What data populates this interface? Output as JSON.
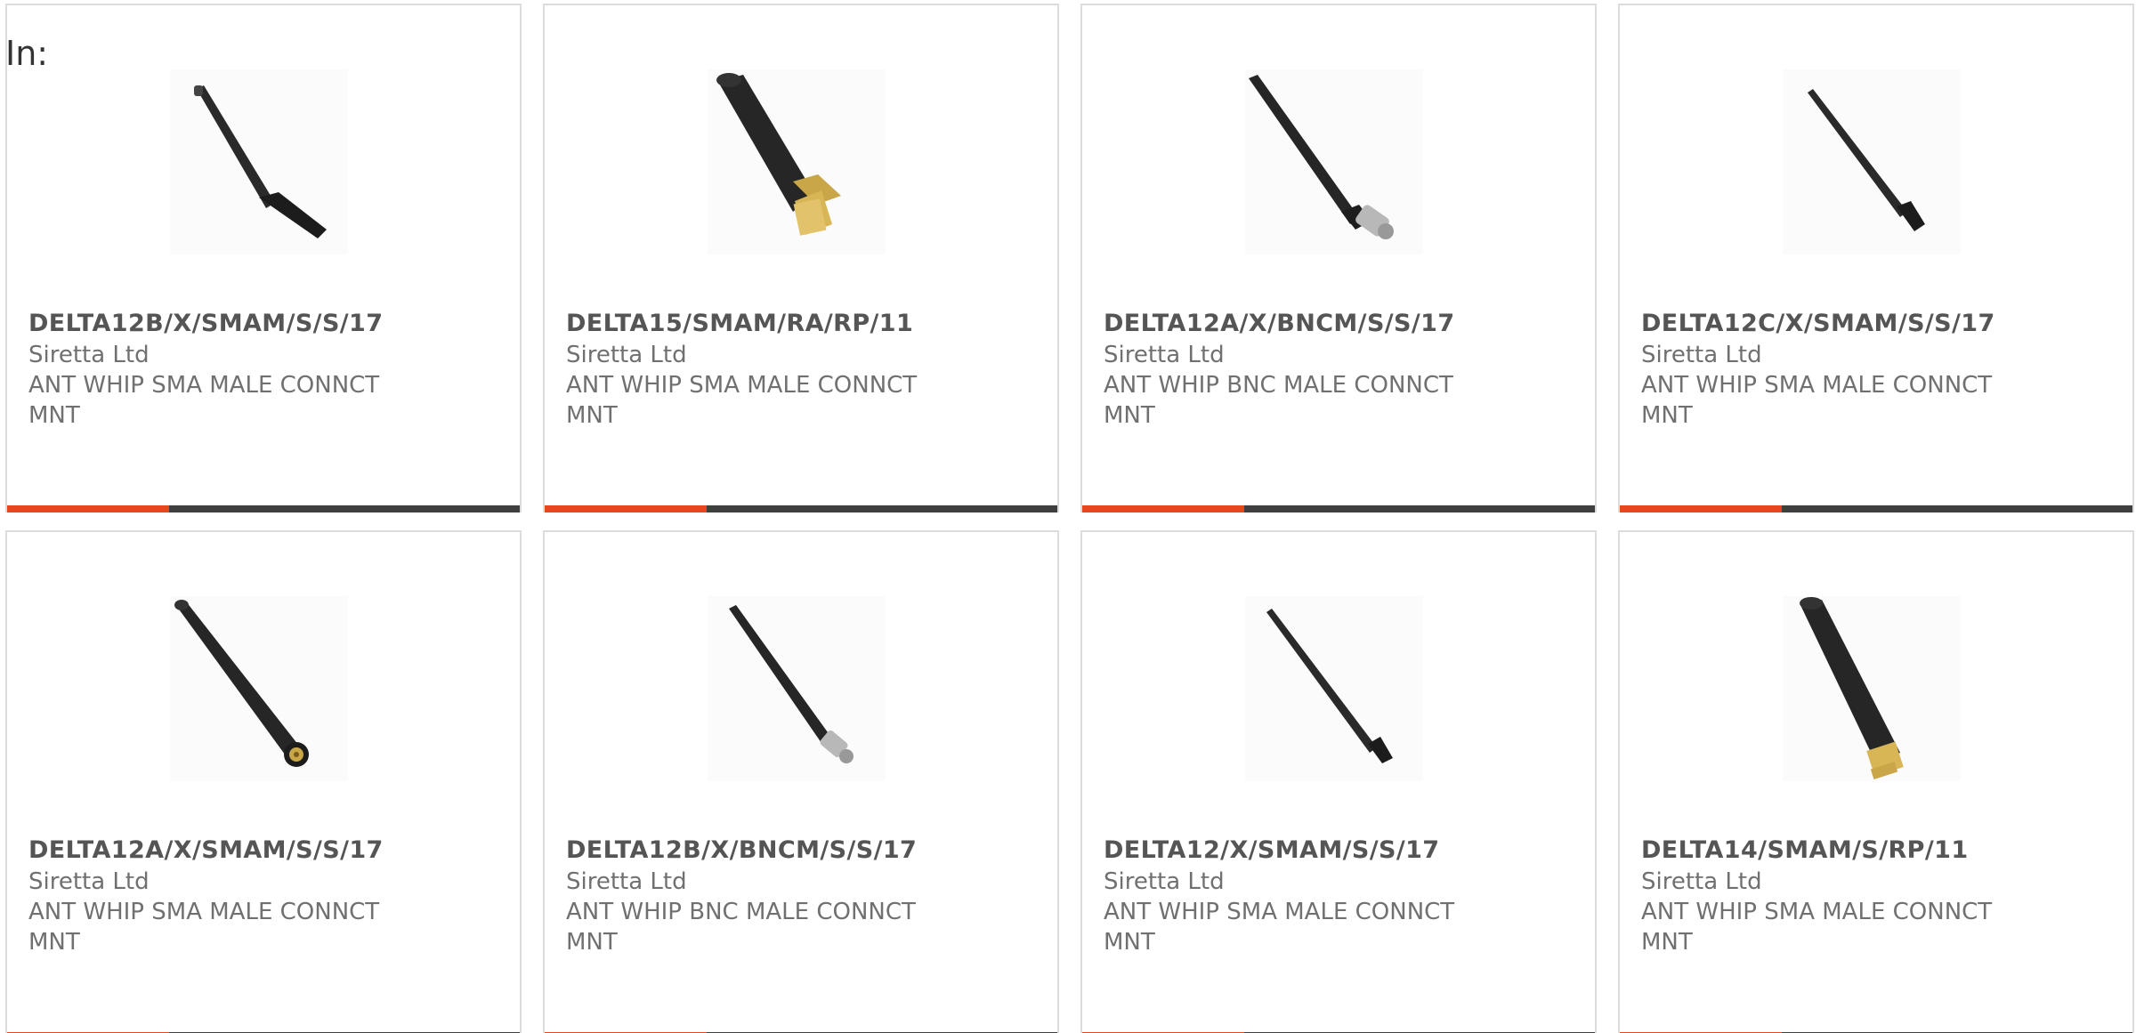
{
  "header": {
    "in_label": "In:"
  },
  "colors": {
    "accent": "#e8461e",
    "bar_dark": "#3f3f3f",
    "card_border": "#dcdcdc",
    "text": "#707070"
  },
  "products": [
    {
      "part": "DELTA12B/X/SMAM/S/S/17",
      "manufacturer": "Siretta Ltd",
      "description": "ANT WHIP SMA MALE CONNCT MNT",
      "image_icon": "whip-antenna-sma-icon"
    },
    {
      "part": "DELTA15/SMAM/RA/RP/11",
      "manufacturer": "Siretta Ltd",
      "description": "ANT WHIP SMA MALE CONNCT MNT",
      "image_icon": "right-angle-antenna-icon"
    },
    {
      "part": "DELTA12A/X/BNCM/S/S/17",
      "manufacturer": "Siretta Ltd",
      "description": "ANT WHIP BNC MALE CONNCT MNT",
      "image_icon": "whip-antenna-bnc-icon"
    },
    {
      "part": "DELTA12C/X/SMAM/S/S/17",
      "manufacturer": "Siretta Ltd",
      "description": "ANT WHIP SMA MALE CONNCT MNT",
      "image_icon": "whip-antenna-sma-icon"
    },
    {
      "part": "DELTA12A/X/SMAM/S/S/17",
      "manufacturer": "Siretta Ltd",
      "description": "ANT WHIP SMA MALE CONNCT MNT",
      "image_icon": "whip-antenna-sma-icon"
    },
    {
      "part": "DELTA12B/X/BNCM/S/S/17",
      "manufacturer": "Siretta Ltd",
      "description": "ANT WHIP BNC MALE CONNCT MNT",
      "image_icon": "whip-antenna-bnc-icon"
    },
    {
      "part": "DELTA12/X/SMAM/S/S/17",
      "manufacturer": "Siretta Ltd",
      "description": "ANT WHIP SMA MALE CONNCT MNT",
      "image_icon": "whip-antenna-sma-icon"
    },
    {
      "part": "DELTA14/SMAM/S/RP/11",
      "manufacturer": "Siretta Ltd",
      "description": "ANT WHIP SMA MALE CONNCT MNT",
      "image_icon": "stubby-antenna-gold-icon"
    }
  ]
}
